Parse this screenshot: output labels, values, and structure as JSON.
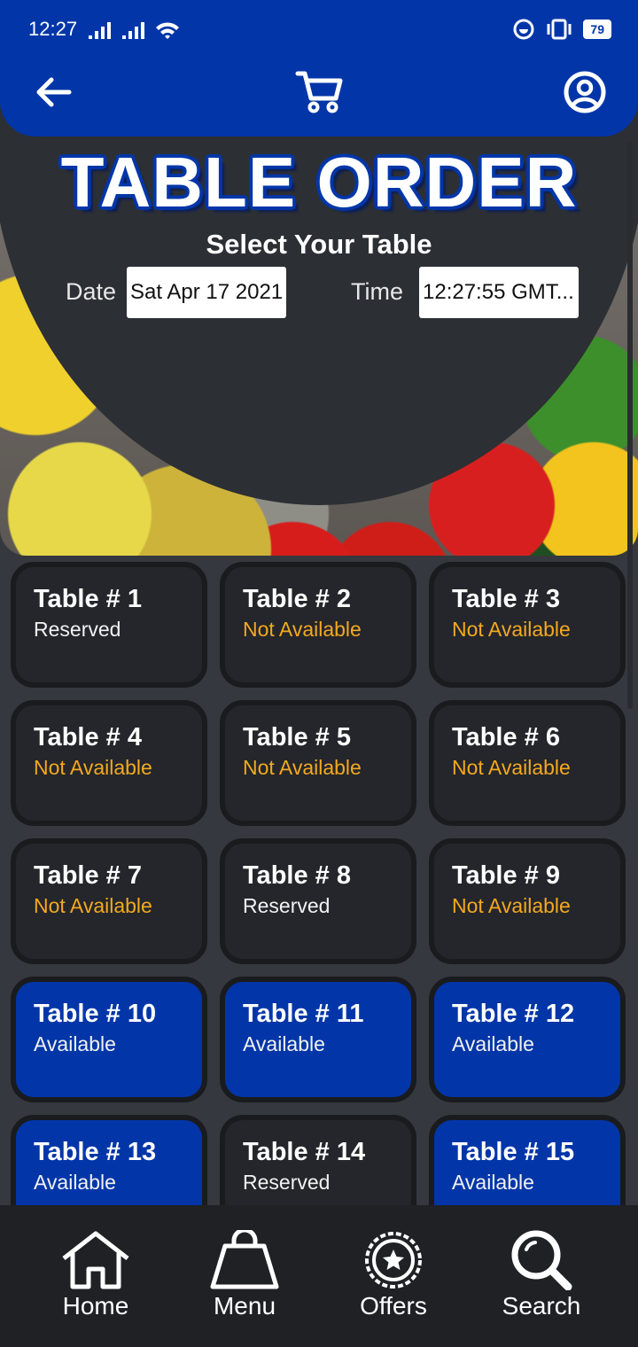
{
  "status": {
    "time": "12:27",
    "battery": "79"
  },
  "header": {
    "back_icon": "arrow-left-icon",
    "cart_icon": "cart-icon",
    "profile_icon": "user-circle-icon",
    "accent": "#0236a8"
  },
  "hero": {
    "title": "TABLE ORDER",
    "subtitle": "Select Your Table",
    "date_label": "Date",
    "date_value": "Sat Apr 17 2021",
    "time_label": "Time",
    "time_value": "12:27:55 GMT..."
  },
  "tables": [
    {
      "name": "Table # 1",
      "status": "Reserved",
      "state": "reserved"
    },
    {
      "name": "Table # 2",
      "status": "Not Available",
      "state": "na"
    },
    {
      "name": "Table # 3",
      "status": "Not Available",
      "state": "na"
    },
    {
      "name": "Table # 4",
      "status": "Not Available",
      "state": "na"
    },
    {
      "name": "Table # 5",
      "status": "Not Available",
      "state": "na"
    },
    {
      "name": "Table # 6",
      "status": "Not Available",
      "state": "na"
    },
    {
      "name": "Table # 7",
      "status": "Not Available",
      "state": "na"
    },
    {
      "name": "Table # 8",
      "status": "Reserved",
      "state": "reserved"
    },
    {
      "name": "Table # 9",
      "status": "Not Available",
      "state": "na"
    },
    {
      "name": "Table # 10",
      "status": "Available",
      "state": "available"
    },
    {
      "name": "Table # 11",
      "status": "Available",
      "state": "available"
    },
    {
      "name": "Table # 12",
      "status": "Available",
      "state": "available"
    },
    {
      "name": "Table # 13",
      "status": "Available",
      "state": "available"
    },
    {
      "name": "Table # 14",
      "status": "Reserved",
      "state": "reserved"
    },
    {
      "name": "Table # 15",
      "status": "Available",
      "state": "available"
    }
  ],
  "bottom_nav": [
    {
      "label": "Home",
      "icon": "home-icon"
    },
    {
      "label": "Menu",
      "icon": "bag-icon"
    },
    {
      "label": "Offers",
      "icon": "badge-star-icon"
    },
    {
      "label": "Search",
      "icon": "search-icon"
    }
  ]
}
